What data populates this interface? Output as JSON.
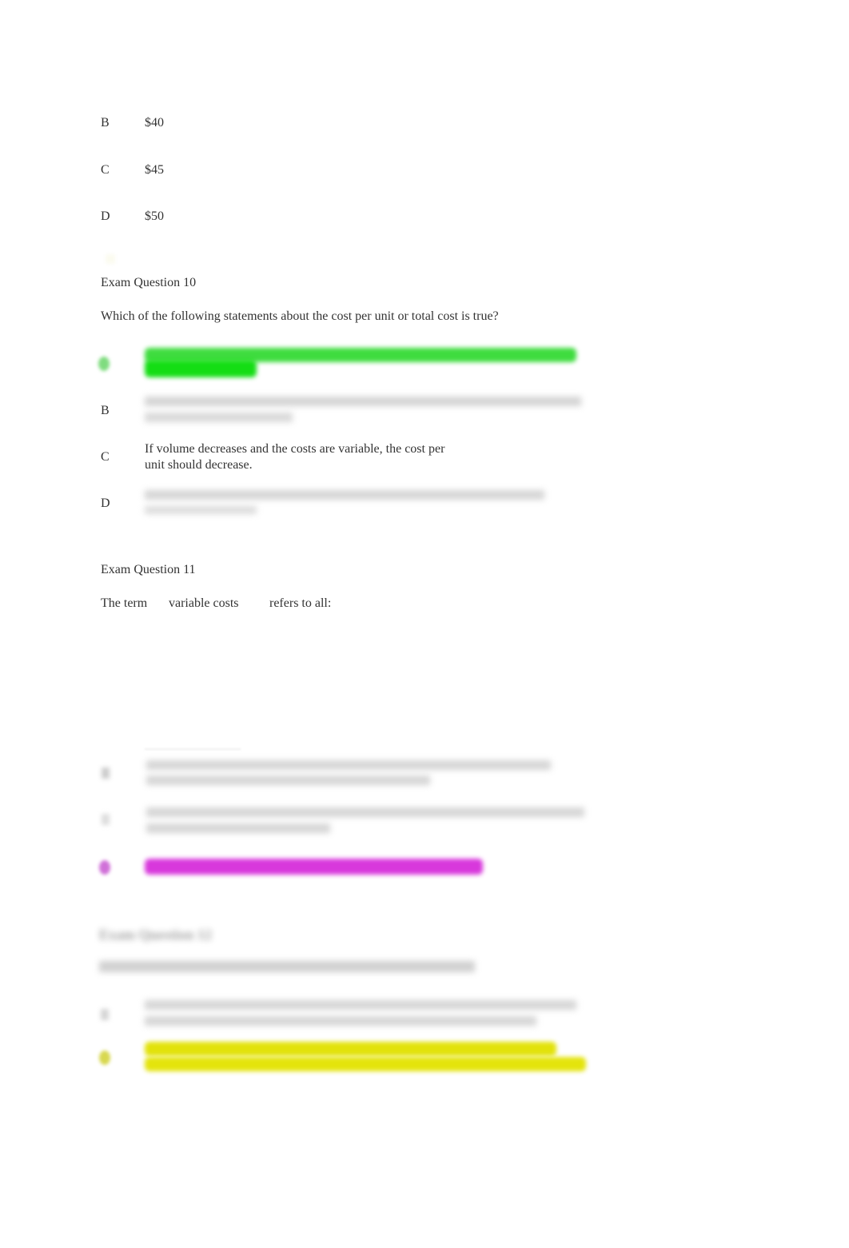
{
  "previous_question": {
    "options": [
      {
        "letter": "B",
        "text": "$40"
      },
      {
        "letter": "C",
        "text": "$45"
      },
      {
        "letter": "D",
        "text": "$50"
      }
    ]
  },
  "question_10": {
    "heading": "Exam Question 10",
    "prompt": "Which of the following statements about the cost per unit or total cost is true?",
    "options": [
      {
        "letter": "A",
        "text": "",
        "state": "highlighted-answer",
        "highlight_color": "#16dd16"
      },
      {
        "letter": "B",
        "text": "",
        "state": "blurred"
      },
      {
        "letter": "C",
        "text_line1": "If volume decreases and the costs are variable, the cost per",
        "text_line2": "unit should decrease.",
        "state": "visible"
      },
      {
        "letter": "D",
        "text": "",
        "state": "blurred"
      }
    ]
  },
  "question_11": {
    "heading": "Exam Question 11",
    "prompt_part1": "The term",
    "prompt_term": "variable costs",
    "prompt_part2": "refers to all:",
    "options": [
      {
        "letter": "B",
        "text": "",
        "state": "blurred"
      },
      {
        "letter": "C",
        "text": "",
        "state": "blurred"
      },
      {
        "letter": "D",
        "text": "",
        "state": "highlighted-answer",
        "highlight_color": "#d838dc"
      }
    ]
  },
  "question_12": {
    "heading": "Exam Question 12",
    "prompt": "",
    "state": "blurred",
    "options": [
      {
        "letter": "A",
        "text": "",
        "state": "blurred"
      },
      {
        "letter": "B",
        "text": "",
        "state": "highlighted-answer",
        "highlight_color": "#e2e20a"
      }
    ]
  }
}
